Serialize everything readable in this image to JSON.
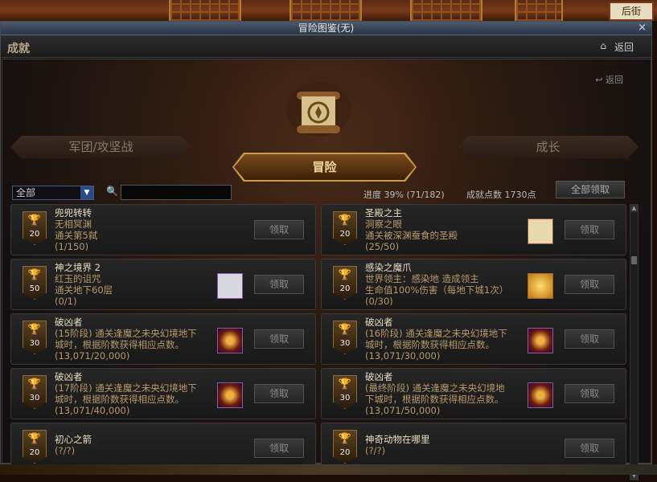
{
  "window": {
    "title": "冒险图鉴(无)",
    "close_label": "×",
    "section": "成就",
    "home_icon": "home-icon",
    "back_label": "返回",
    "small_back_label": "返回"
  },
  "scene": {
    "sign_text": "后街"
  },
  "categories": {
    "left": "军团/攻坚战",
    "right": "成长",
    "active": "冒险"
  },
  "filter": {
    "selected": "全部",
    "search_value": "",
    "progress": "进度  39% (71/182)",
    "points": "成就点数 1730点",
    "claim_all": "全部领取"
  },
  "achievements": [
    {
      "name": "兜兜转转",
      "lines": [
        "无相冥渊",
        "通关第5弑"
      ],
      "count": "(1/150)",
      "points": "20",
      "icon": "",
      "gold": false
    },
    {
      "name": "圣殿之主",
      "lines": [
        "洞察之眼",
        "通关被深渊蚕食的圣殿"
      ],
      "count": "(25/50)",
      "points": "20",
      "icon": "frame",
      "gold": false
    },
    {
      "name": "神之境界 2",
      "lines": [
        "红玉的诅咒",
        "通关地下60层"
      ],
      "count": "(0/1)",
      "points": "50",
      "icon": "scroll",
      "gold": true
    },
    {
      "name": "感染之魔爪",
      "lines": [
        "世界领主：感染地         造成领主",
        "生命值100%伤害（每地下城1次）"
      ],
      "count": "(0/30)",
      "points": "20",
      "icon": "gold",
      "gold": false
    },
    {
      "name": "破凶者",
      "lines": [
        "(15阶段) 通关逢魔之未央幻境地下",
        "城时，根据阶数获得相应点数。"
      ],
      "count": "(13,071/20,000)",
      "points": "30",
      "icon": "purple",
      "gold": false
    },
    {
      "name": "破凶者",
      "lines": [
        "(16阶段) 通关逢魔之未央幻境地下",
        "城时，根据阶数获得相应点数。"
      ],
      "count": "(13,071/30,000)",
      "points": "30",
      "icon": "purple",
      "gold": false
    },
    {
      "name": "破凶者",
      "lines": [
        "(17阶段) 通关逢魔之未央幻境地下",
        "城时，根据阶数获得相应点数。"
      ],
      "count": "(13,071/40,000)",
      "points": "30",
      "icon": "purple",
      "gold": false
    },
    {
      "name": "破凶者",
      "lines": [
        "(最终阶段) 通关逢魔之未央幻境地",
        "下城时，根据阶数获得相应点数。"
      ],
      "count": "(13,071/50,000)",
      "points": "30",
      "icon": "purple",
      "gold": false
    },
    {
      "name": "初心之箭",
      "lines": [
        "(?/?)"
      ],
      "count": "",
      "points": "20",
      "icon": "",
      "gold": false
    },
    {
      "name": "神奇动物在哪里",
      "lines": [
        "(?/?)"
      ],
      "count": "",
      "points": "20",
      "icon": "",
      "gold": false
    }
  ],
  "claim_label": "领取"
}
